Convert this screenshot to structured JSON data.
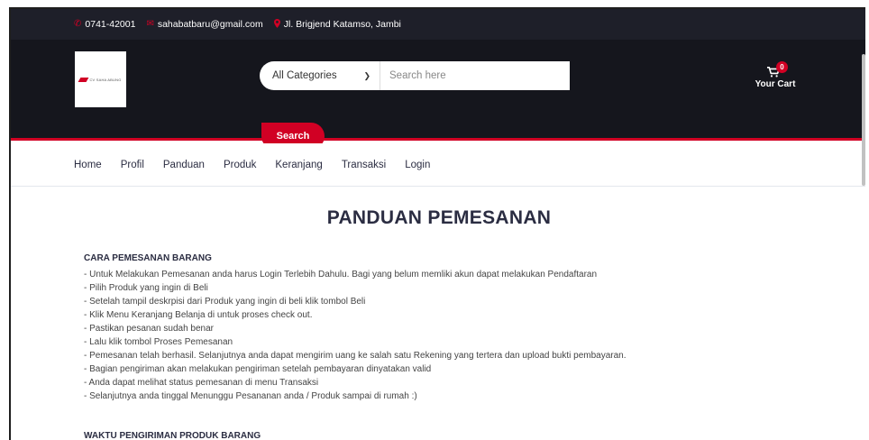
{
  "topbar": {
    "phone": "0741-42001",
    "email": "sahabatbaru@gmail.com",
    "address": "Jl. Brigjend Katamso, Jambi"
  },
  "header": {
    "logo_text": "CV SAHA ABUNG",
    "category_selected": "All Categories",
    "search_placeholder": "Search here",
    "search_button": "Search",
    "cart_count": "0",
    "cart_label": "Your Cart"
  },
  "nav": {
    "items": [
      "Home",
      "Profil",
      "Panduan",
      "Produk",
      "Keranjang",
      "Transaksi",
      "Login"
    ]
  },
  "main": {
    "title": "PANDUAN PEMESANAN",
    "section1_title": "CARA PEMESANAN BARANG",
    "section1_lines": [
      "- Untuk Melakukan Pemesanan anda harus Login Terlebih Dahulu. Bagi yang belum memliki akun dapat melakukan Pendaftaran",
      "- Pilih Produk yang ingin di Beli",
      "- Setelah tampil deskrpisi dari Produk yang ingin di beli klik tombol Beli",
      "- Klik Menu Keranjang Belanja di untuk proses check out.",
      "- Pastikan pesanan sudah benar",
      "- Lalu klik tombol Proses Pemesanan",
      "- Pemesanan telah berhasil. Selanjutnya anda dapat mengirim uang ke salah satu Rekening yang tertera dan upload bukti pembayaran.",
      "- Bagian pengiriman akan melakukan pengiriman setelah pembayaran dinyatakan valid",
      "- Anda dapat melihat status pemesanan di menu Transaksi",
      "- Selanjutnya anda tinggal Menunggu Pesananan anda / Produk sampai di rumah :)"
    ],
    "section2_title": "WAKTU PENGIRIMAN PRODUK BARANG"
  },
  "colors": {
    "accent": "#D10024",
    "topbar_bg": "#1e1f29",
    "header_bg": "#15161d"
  },
  "icons": {
    "phone": "phone-icon",
    "email": "envelope-icon",
    "address": "map-marker-icon",
    "cart": "shopping-cart-icon",
    "select": "chevron-down-icon"
  }
}
